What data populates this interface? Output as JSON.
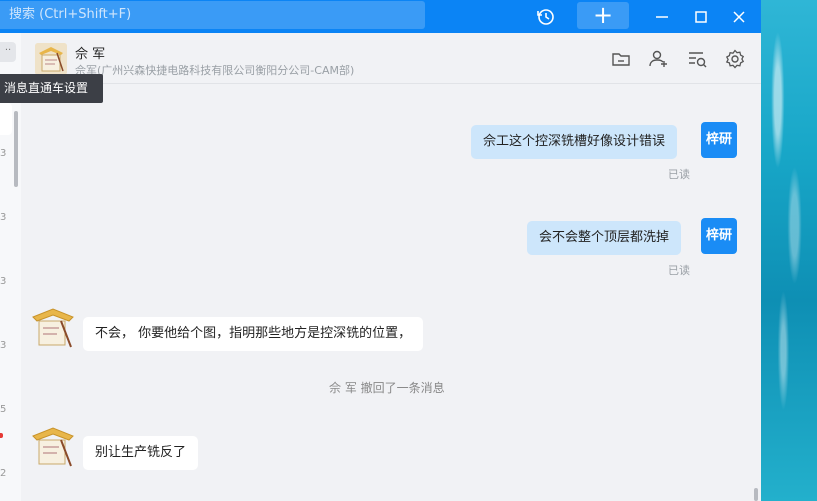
{
  "titlebar": {
    "search_placeholder": "搜索 (Ctrl+Shift+F)",
    "plus_label": "+",
    "icons": [
      "history-icon",
      "minimize-icon",
      "maximize-icon",
      "close-icon"
    ]
  },
  "tooltip": {
    "text": "消息直通车设置"
  },
  "left_column": {
    "more_label": "··",
    "numbers": [
      "3",
      "3",
      "3",
      "3",
      "5",
      "2"
    ]
  },
  "header": {
    "contact_name": "佘 军",
    "contact_subtitle": "佘军(广州兴森快捷电路科技有限公司衡阳分公司-CAM部)",
    "icons": [
      "folder-icon",
      "add-user-icon",
      "search-history-icon",
      "settings-icon"
    ]
  },
  "messages": [
    {
      "type": "out",
      "text": "佘工这个控深铣槽好像设计错误",
      "avatar_label": "梓研",
      "status": "已读"
    },
    {
      "type": "out",
      "text": "会不会整个顶层都洗掉",
      "avatar_label": "梓研",
      "status": "已读"
    },
    {
      "type": "in",
      "text": "不会， 你要他给个图，指明那些地方是控深铣的位置，"
    },
    {
      "type": "system",
      "text": "佘 军 撤回了一条消息"
    },
    {
      "type": "in",
      "text": "别让生产铣反了"
    }
  ],
  "colors": {
    "titlebar": "#0b84f5",
    "outgoing_bubble": "#cde6fb",
    "incoming_bubble": "#ffffff",
    "my_avatar": "#1a8cf5",
    "background": "#f1f2f5"
  }
}
